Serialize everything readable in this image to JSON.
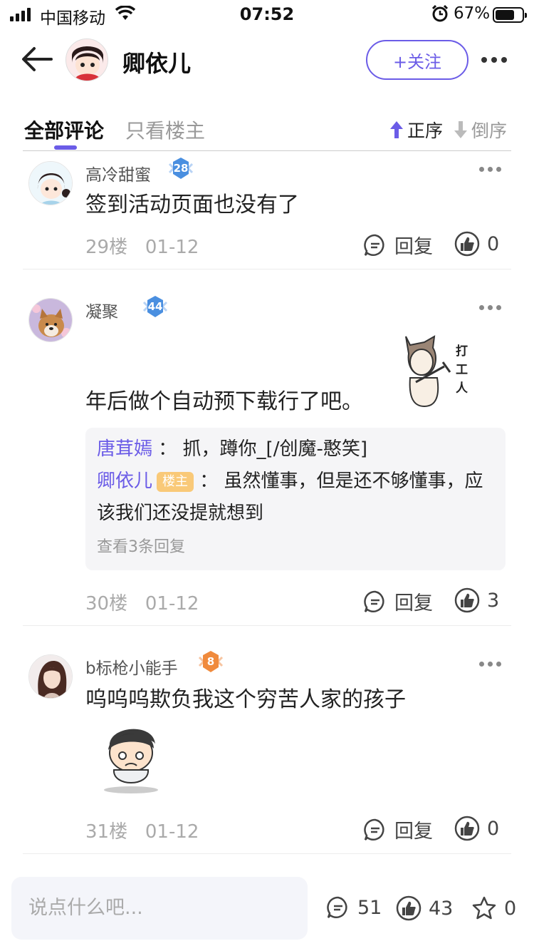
{
  "status_bar": {
    "carrier": "中国移动",
    "time": "07:52",
    "battery": "67%"
  },
  "nav": {
    "title": "卿依儿",
    "follow_label": "+关注"
  },
  "tabs": {
    "all_comments": "全部评论",
    "owner_only": "只看楼主",
    "sort_asc": "正序",
    "sort_desc": "倒序"
  },
  "comments": [
    {
      "name": "高冷甜蜜",
      "level": "28",
      "text": "签到活动页面也没有了",
      "floor": "29楼",
      "date": "01-12",
      "reply_label": "回复",
      "likes": "0"
    },
    {
      "name": "凝聚",
      "level": "44",
      "text": "年后做个自动预下载行了吧。",
      "sticker_text": "打工人",
      "floor": "30楼",
      "date": "01-12",
      "reply_label": "回复",
      "likes": "3",
      "replies": [
        {
          "who": "唐茸嫣",
          "text": "抓，蹲你_[/创魔-憨笑]"
        },
        {
          "who": "卿依儿",
          "tag": "楼主",
          "text": "虽然懂事，但是还不够懂事，应该我们还没提就想到"
        }
      ],
      "view_more": "查看3条回复"
    },
    {
      "name": "b标枪小能手",
      "level": "8",
      "text": "呜呜呜欺负我这个穷苦人家的孩子",
      "floor": "31楼",
      "date": "01-12",
      "reply_label": "回复",
      "likes": "0"
    }
  ],
  "bottom_bar": {
    "placeholder": "说点什么吧...",
    "comments_count": "51",
    "likes_count": "43",
    "favorites_count": "0"
  },
  "colors": {
    "accent": "#6b5ce7",
    "owner_tag": "#f9c978",
    "level_badge": "#4a8fe0",
    "level_badge_orange": "#f08a3c"
  }
}
